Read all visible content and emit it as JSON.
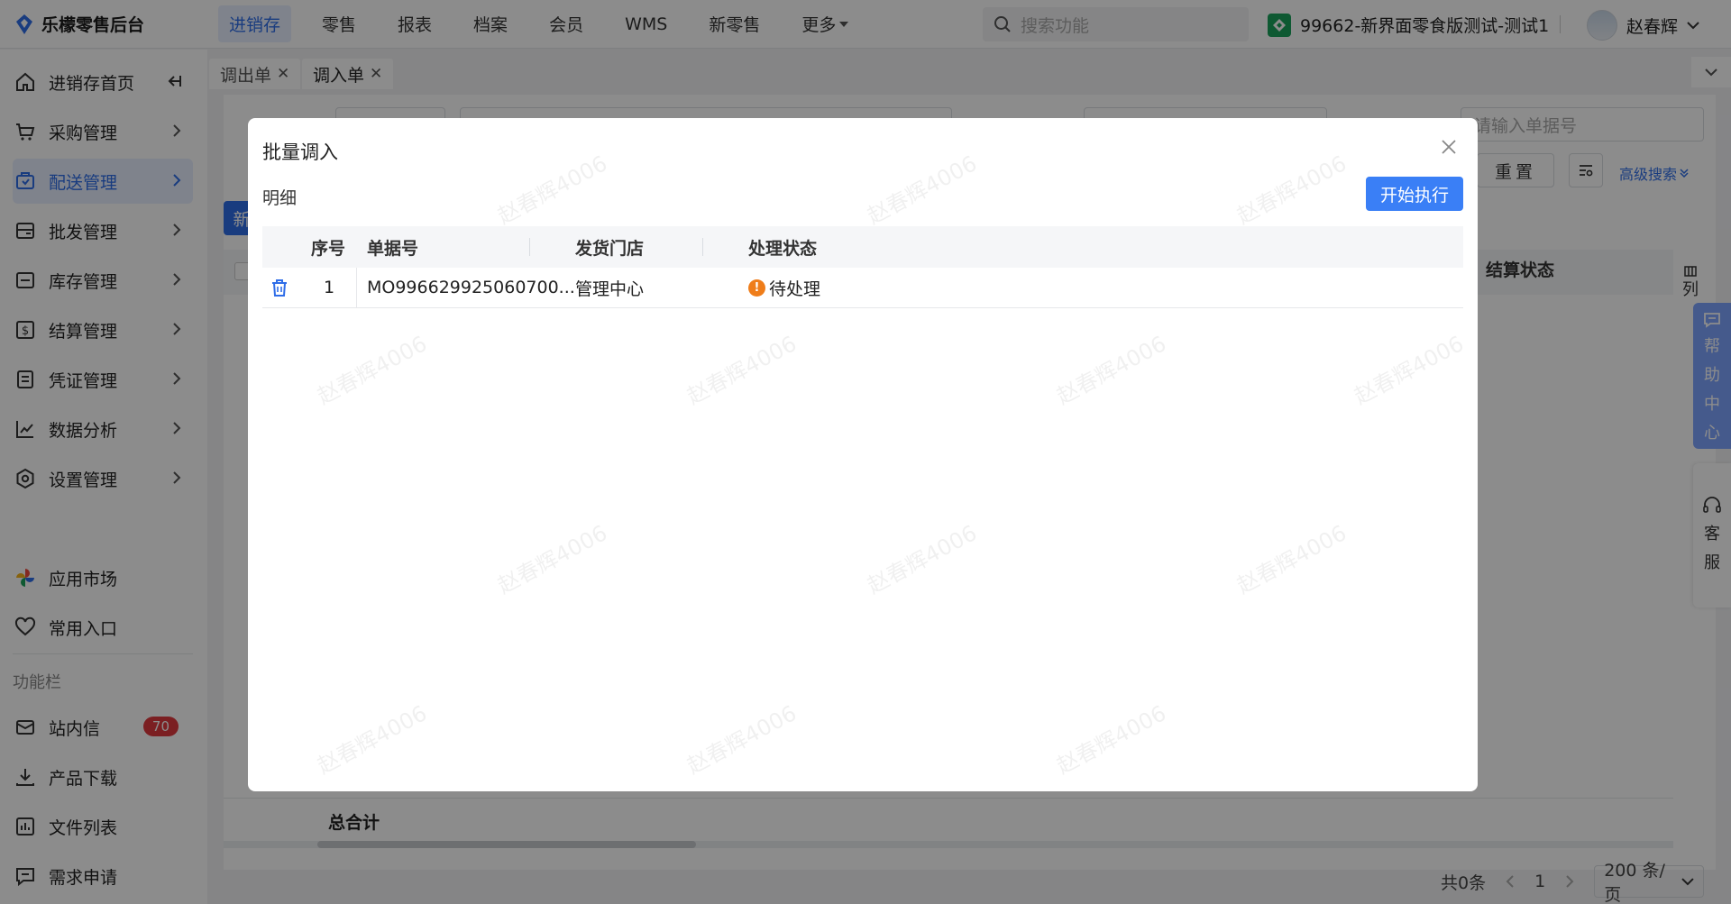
{
  "app": {
    "name": "乐檬零售后台"
  },
  "nav": {
    "items": [
      "进销存",
      "零售",
      "报表",
      "档案",
      "会员",
      "WMS",
      "新零售"
    ],
    "more": "更多",
    "search_placeholder": "搜索功能",
    "store": "99662-新界面零食版测试-测试1",
    "user": "赵春辉"
  },
  "sidebar": {
    "items": [
      {
        "label": "进销存首页"
      },
      {
        "label": "采购管理"
      },
      {
        "label": "配送管理"
      },
      {
        "label": "批发管理"
      },
      {
        "label": "库存管理"
      },
      {
        "label": "结算管理"
      },
      {
        "label": "凭证管理"
      },
      {
        "label": "数据分析"
      },
      {
        "label": "设置管理"
      }
    ],
    "extra": [
      "应用市场",
      "常用入口"
    ],
    "section": "功能栏",
    "tools": [
      "站内信",
      "产品下载",
      "文件列表",
      "需求申请"
    ],
    "message_count": "70"
  },
  "tabs": [
    {
      "label": "调出单"
    },
    {
      "label": "调入单"
    }
  ],
  "page": {
    "doc_input_placeholder": "请输入单据号",
    "reset": "重置",
    "advanced_search": "高级搜索",
    "new_label": "新",
    "col_settle_status": "结算状态",
    "column_ctrl": "列",
    "total_label": "总合计",
    "total_count": "共0条",
    "current_page": "1",
    "page_size": "200 条/页"
  },
  "float": {
    "help": [
      "帮",
      "助",
      "中",
      "心"
    ],
    "service": [
      "客",
      "服"
    ]
  },
  "modal": {
    "title": "批量调入",
    "detail_label": "明细",
    "start_button": "开始执行",
    "columns": [
      "序号",
      "单据号",
      "发货门店",
      "处理状态"
    ],
    "rows": [
      {
        "index": "1",
        "doc_no": "MO996629925060700...",
        "store": "管理中心",
        "status": "待处理"
      }
    ]
  },
  "watermark": "赵春辉4006",
  "colors": {
    "accent": "#2f6de8",
    "pending": "#ef7d1a",
    "help": "#7ea4ff"
  }
}
